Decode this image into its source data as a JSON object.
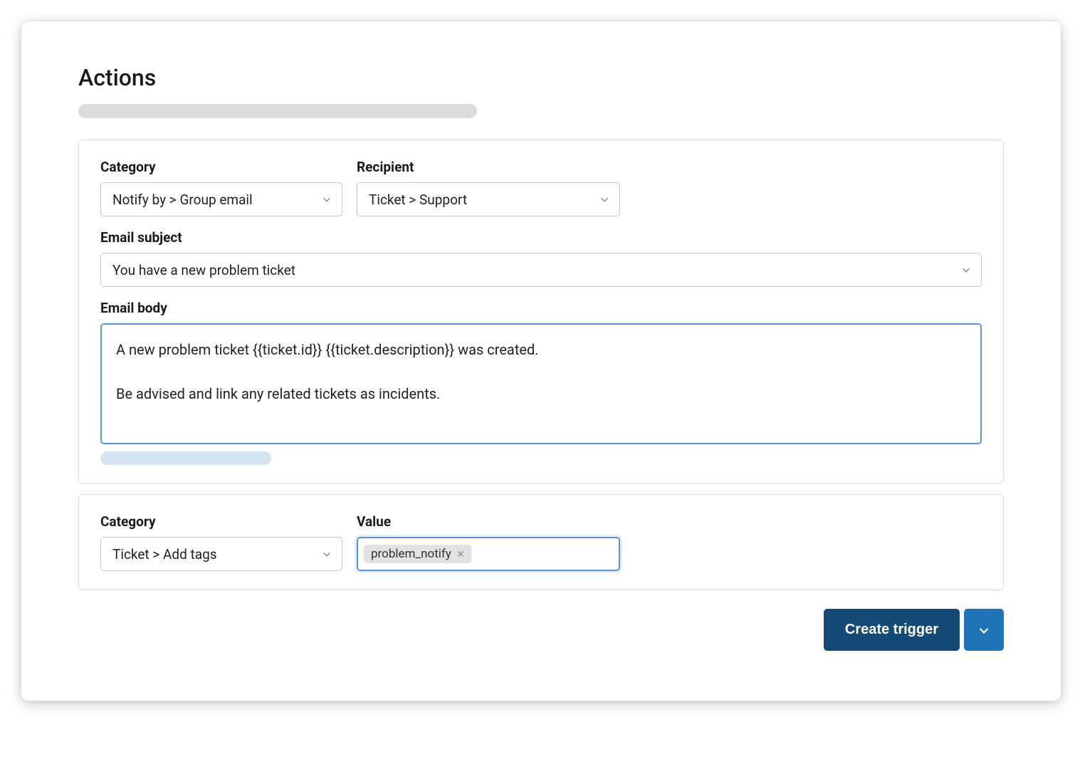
{
  "page": {
    "title": "Actions"
  },
  "action1": {
    "category_label": "Category",
    "category_value": "Notify by > Group email",
    "recipient_label": "Recipient",
    "recipient_value": "Ticket > Support",
    "subject_label": "Email subject",
    "subject_value": "You have a new problem ticket",
    "body_label": "Email body",
    "body_value": "A new problem ticket {{ticket.id}} {{ticket.description}} was created.\n\nBe advised and link any related tickets as incidents."
  },
  "action2": {
    "category_label": "Category",
    "category_value": "Ticket > Add tags",
    "value_label": "Value",
    "tags": [
      "problem_notify"
    ]
  },
  "footer": {
    "create_button": "Create trigger"
  }
}
